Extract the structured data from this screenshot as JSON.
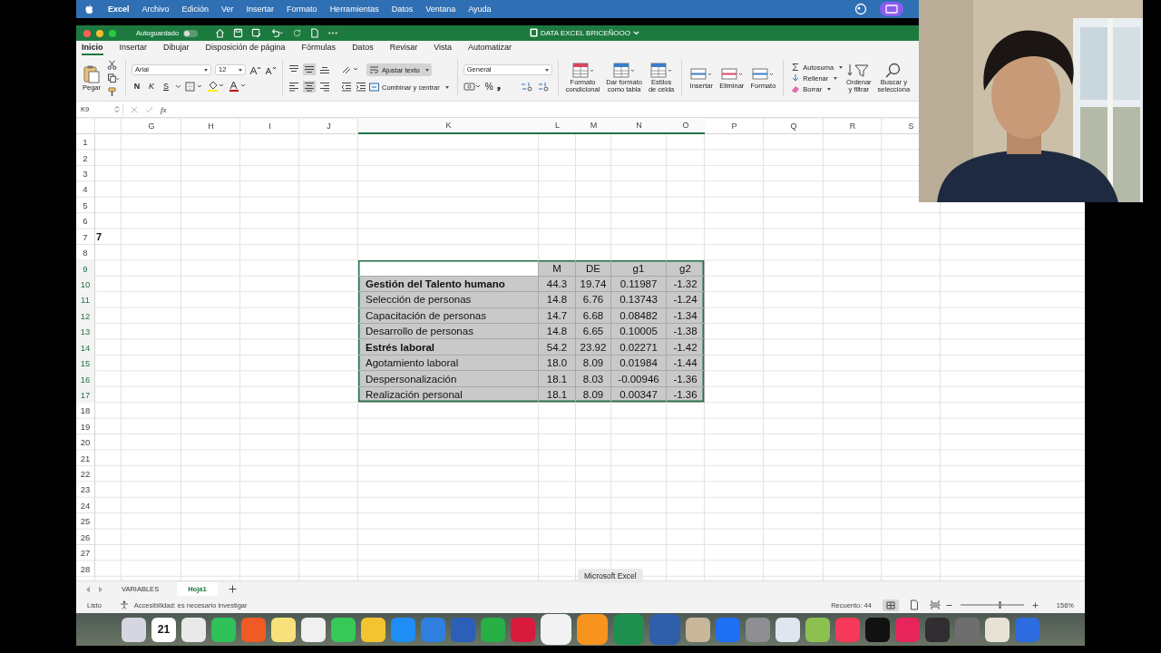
{
  "menubar": {
    "app": "Excel",
    "items": [
      "Archivo",
      "Edición",
      "Ver",
      "Insertar",
      "Formato",
      "Herramientas",
      "Datos",
      "Ventana",
      "Ayuda"
    ]
  },
  "window": {
    "autosave_label": "Autoguardado",
    "autosave_on": false,
    "title": "DATA EXCEL BRICEÑOOO"
  },
  "ribbon_tabs": [
    {
      "label": "Inicio",
      "selected": true
    },
    {
      "label": "Insertar",
      "selected": false
    },
    {
      "label": "Dibujar",
      "selected": false
    },
    {
      "label": "Disposición de página",
      "selected": false
    },
    {
      "label": "Fórmulas",
      "selected": false
    },
    {
      "label": "Datos",
      "selected": false
    },
    {
      "label": "Revisar",
      "selected": false
    },
    {
      "label": "Vista",
      "selected": false
    },
    {
      "label": "Automatizar",
      "selected": false
    }
  ],
  "ribbon": {
    "paste": "Pegar",
    "font": "Arial",
    "font_size": "12",
    "bold": "N",
    "italic": "K",
    "underline": "S",
    "wrap_text": {
      "label": "Ajustar texto",
      "on": true
    },
    "merge": "Combinar y centrar",
    "number_format": "General",
    "percent": "%",
    "comma": "❟",
    "style_buttons": [
      {
        "lines": [
          "Formato",
          "condicional"
        ]
      },
      {
        "lines": [
          "Dar formato",
          "como tabla"
        ]
      },
      {
        "lines": [
          "Estilos",
          "de celda"
        ]
      }
    ],
    "cell_buttons": [
      "Insertar",
      "Eliminar",
      "Formato"
    ],
    "edit_items": [
      "Autosuma",
      "Rellenar",
      "Borrar"
    ],
    "sort": [
      "Ordenar",
      "y filtrar"
    ],
    "find": [
      "Buscar y",
      "selecciona"
    ]
  },
  "formula_bar": {
    "cell_ref": "K9",
    "fx": "fx"
  },
  "columns": [
    {
      "label": "G",
      "selected": false
    },
    {
      "label": "H",
      "selected": false
    },
    {
      "label": "I",
      "selected": false
    },
    {
      "label": "J",
      "selected": false
    },
    {
      "label": "K",
      "selected": true
    },
    {
      "label": "L",
      "selected": true
    },
    {
      "label": "M",
      "selected": true
    },
    {
      "label": "N",
      "selected": true
    },
    {
      "label": "O",
      "selected": true
    },
    {
      "label": "P",
      "selected": false
    },
    {
      "label": "Q",
      "selected": false
    },
    {
      "label": "R",
      "selected": false
    },
    {
      "label": "S",
      "selected": false
    }
  ],
  "rows": [
    {
      "label": "1",
      "selected": false
    },
    {
      "label": "2",
      "selected": false
    },
    {
      "label": "3",
      "selected": false
    },
    {
      "label": "4",
      "selected": false
    },
    {
      "label": "5",
      "selected": false
    },
    {
      "label": "6",
      "selected": false
    },
    {
      "label": "7",
      "selected": false
    },
    {
      "label": "8",
      "selected": false
    },
    {
      "label": "9",
      "selected": true
    },
    {
      "label": "10",
      "selected": true
    },
    {
      "label": "11",
      "selected": true
    },
    {
      "label": "12",
      "selected": true
    },
    {
      "label": "13",
      "selected": true
    },
    {
      "label": "14",
      "selected": true
    },
    {
      "label": "15",
      "selected": true
    },
    {
      "label": "16",
      "selected": true
    },
    {
      "label": "17",
      "selected": true
    },
    {
      "label": "18",
      "selected": false
    },
    {
      "label": "19",
      "selected": false
    },
    {
      "label": "20",
      "selected": false
    },
    {
      "label": "21",
      "selected": false
    },
    {
      "label": "22",
      "selected": false
    },
    {
      "label": "23",
      "selected": false
    },
    {
      "label": "24",
      "selected": false
    },
    {
      "label": "25",
      "selected": false
    },
    {
      "label": "26",
      "selected": false
    },
    {
      "label": "27",
      "selected": false
    },
    {
      "label": "28",
      "selected": false
    }
  ],
  "cut_cell_text": "7",
  "table": {
    "header": [
      "M",
      "DE",
      "g1",
      "g2"
    ],
    "rows": [
      {
        "label": "Gestión del Talento humano",
        "bold": true,
        "values": [
          "44.3",
          "19.74",
          "0.11987",
          "-1.32"
        ]
      },
      {
        "label": "Selección de personas",
        "bold": false,
        "values": [
          "14.8",
          "6.76",
          "0.13743",
          "-1.24"
        ]
      },
      {
        "label": "Capacitación de personas",
        "bold": false,
        "values": [
          "14.7",
          "6.68",
          "0.08482",
          "-1.34"
        ]
      },
      {
        "label": "Desarrollo de personas",
        "bold": false,
        "values": [
          "14.8",
          "6.65",
          "0.10005",
          "-1.38"
        ]
      },
      {
        "label": "Estrés laboral",
        "bold": true,
        "values": [
          "54.2",
          "23.92",
          "0.02271",
          "-1.42"
        ]
      },
      {
        "label": "Agotamiento laboral",
        "bold": false,
        "values": [
          "18.0",
          "8.09",
          "0.01984",
          "-1.44"
        ]
      },
      {
        "label": "Despersonalización",
        "bold": false,
        "values": [
          "18.1",
          "8.03",
          "-0.00946",
          "-1.36"
        ]
      },
      {
        "label": "Realización personal",
        "bold": false,
        "values": [
          "18.1",
          "8.09",
          "0.00347",
          "-1.36"
        ]
      }
    ]
  },
  "sheet_tabs": [
    {
      "label": "VARIABLES",
      "selected": false
    },
    {
      "label": "Hoja1",
      "selected": true
    }
  ],
  "status_bar": {
    "ready": "Listo",
    "accessibility": "Accesibilidad: es necesario investigar",
    "count": "Recuento: 44",
    "zoom": "156%",
    "zoom_level": {
      "level": 0.62
    }
  },
  "tooltip": "Microsoft Excel",
  "dock": [
    {
      "kind": "app",
      "color": "#d5d6e0",
      "magnified": false
    },
    {
      "kind": "calendar",
      "color": "#ffffff",
      "magnified": false,
      "text": "21"
    },
    {
      "kind": "app",
      "color": "#e9e9e9",
      "magnified": false
    },
    {
      "kind": "app",
      "color": "#2fc15a",
      "magnified": false
    },
    {
      "kind": "app",
      "color": "#f05a24",
      "magnified": false
    },
    {
      "kind": "app",
      "color": "#f7e17a",
      "magnified": false
    },
    {
      "kind": "app",
      "color": "#f0f0f0",
      "magnified": false
    },
    {
      "kind": "app",
      "color": "#37c85a",
      "magnified": false
    },
    {
      "kind": "app",
      "color": "#f4c430",
      "magnified": false
    },
    {
      "kind": "app",
      "color": "#1e8df5",
      "magnified": false
    },
    {
      "kind": "app",
      "color": "#2f7fe0",
      "magnified": false
    },
    {
      "kind": "app",
      "color": "#2b5fb8",
      "magnified": false
    },
    {
      "kind": "app",
      "color": "#27b046",
      "magnified": false
    },
    {
      "kind": "app",
      "color": "#d81b3c",
      "magnified": false
    },
    {
      "kind": "app",
      "color": "#f2f2f2",
      "magnified": true
    },
    {
      "kind": "app",
      "color": "#f7931e",
      "magnified": true
    },
    {
      "kind": "app",
      "color": "#1e8f4e",
      "magnified": true
    },
    {
      "kind": "app",
      "color": "#2f5faa",
      "magnified": true
    },
    {
      "kind": "app",
      "color": "#c9b79c",
      "magnified": false
    },
    {
      "kind": "app",
      "color": "#1f6ff5",
      "magnified": false
    },
    {
      "kind": "app",
      "color": "#8e8e93",
      "magnified": false
    },
    {
      "kind": "app",
      "color": "#dfe6f0",
      "magnified": false
    },
    {
      "kind": "app",
      "color": "#8cc152",
      "magnified": false
    },
    {
      "kind": "app",
      "color": "#f6385a",
      "magnified": false
    },
    {
      "kind": "app",
      "color": "#111111",
      "magnified": false
    },
    {
      "kind": "app",
      "color": "#e8245c",
      "magnified": false
    },
    {
      "kind": "app",
      "color": "#302e31",
      "magnified": false
    },
    {
      "kind": "app",
      "color": "#6e6e6e",
      "magnified": false
    },
    {
      "kind": "app",
      "color": "#e6e2d6",
      "magnified": false
    },
    {
      "kind": "app",
      "color": "#2d6be0",
      "magnified": false
    }
  ]
}
